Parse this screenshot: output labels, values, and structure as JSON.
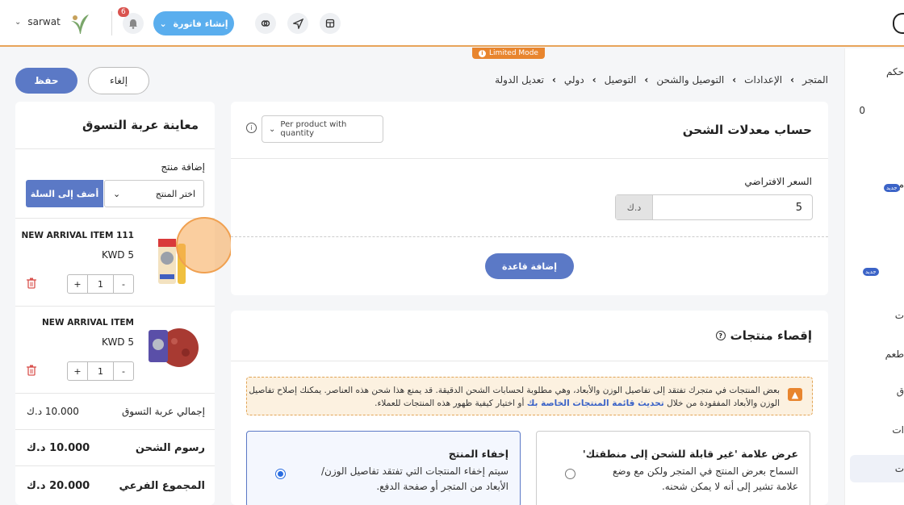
{
  "topbar": {
    "user_name": "sarwat",
    "notifications_count": "6",
    "create_invoice_label": "إنشاء فاتورة",
    "limited_mode": "Limited Mode"
  },
  "sidebar": {
    "items": [
      "حكم",
      "0",
      "م",
      "جديد",
      "جديد",
      "ت",
      "طعم",
      "ق",
      "ات",
      "ت"
    ]
  },
  "actions": {
    "save": "حفظ",
    "cancel": "إلغاء"
  },
  "breadcrumb": [
    "المتجر",
    "الإعدادات",
    "التوصيل والشحن",
    "التوصيل",
    "دولي",
    "تعديل الدولة"
  ],
  "cart": {
    "title": "معاينة عربة التسوق",
    "add_product_label": "إضافة منتج",
    "select_placeholder": "اختر المنتج",
    "add_to_cart": "أضف إلى السلة",
    "items": [
      {
        "name": "NEW ARRIVAL ITEM 111",
        "price": "KWD 5",
        "qty": "1"
      },
      {
        "name": "NEW ARRIVAL ITEM",
        "price": "KWD 5",
        "qty": "1"
      }
    ],
    "qty_plus": "+",
    "qty_minus": "-",
    "total_label": "إجمالي عربة التسوق",
    "total_value": "10.000 د.ك",
    "shipping_label": "رسوم الشحن",
    "shipping_value": "10.000 د.ك",
    "subtotal_label": "المجموع الفرعي",
    "subtotal_value": "20.000 د.ك"
  },
  "rates": {
    "title": "حساب معدلات الشحن",
    "method": "Per product with quantity",
    "default_price_label": "السعر الافتراضي",
    "default_price_value": "5",
    "currency": "د.ك",
    "add_rule": "إضافة قاعدة"
  },
  "exclude": {
    "title": "إقصاء منتجات",
    "warning_text": "بعض المنتجات في متجرك تفتقد إلى تفاصيل الوزن والأبعاد، وهي مطلوبة لحسابات الشحن الدقيقة. قد يمنع هذا شحن هذه العناصر. يمكنك إصلاح تفاصيل الوزن والأبعاد المفقودة من خلال",
    "warning_link": "تحديث قائمة المنتجات الخاصة بك",
    "warning_tail": "أو اختيار كيفية ظهور هذه المنتجات للعملاء.",
    "option_label_title": "عرض علامة 'غير قابلة للشحن إلى منطقتك'",
    "option_label_desc": "السماح بعرض المنتج في المتجر ولكن مع وضع علامة تشير إلى أنه لا يمكن شحنه.",
    "option_hide_title": "إخفاء المنتج",
    "option_hide_desc": "سيتم إخفاء المنتجات التي تفتقد تفاصيل الوزن/الأبعاد من المتجر أو صفحة الدفع.",
    "selected_option": "hide"
  },
  "colors": {
    "primary": "#5b79c6",
    "accent": "#e8852e",
    "invoice": "#5aaeee"
  }
}
